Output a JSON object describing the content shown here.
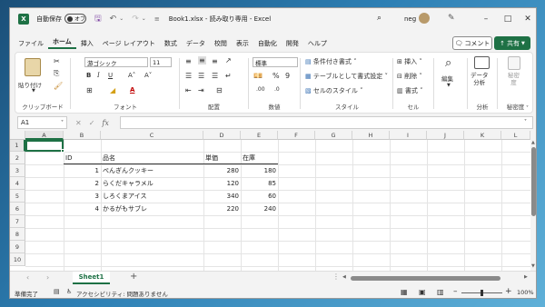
{
  "title": {
    "autosave_label": "自動保存",
    "autosave_state": "オフ",
    "doc_title": "Book1.xlsx  -  読み取り専用  -  Excel",
    "user": "neg"
  },
  "menu": [
    "ファイル",
    "ホーム",
    "挿入",
    "ページ レイアウト",
    "数式",
    "データ",
    "校閲",
    "表示",
    "自動化",
    "開発",
    "ヘルプ"
  ],
  "comment_label": "コメント",
  "share_label": "共有",
  "ribbon": {
    "clipboard": {
      "paste": "貼り付け",
      "label": "クリップボード"
    },
    "font": {
      "name": "游ゴシック",
      "size": "11",
      "label": "フォント"
    },
    "alignment": {
      "label": "配置"
    },
    "number": {
      "format": "標準",
      "label": "数値"
    },
    "styles": {
      "cond": "条件付き書式",
      "table": "テーブルとして書式設定",
      "cell": "セルのスタイル",
      "label": "スタイル"
    },
    "cells": {
      "insert": "挿入",
      "delete": "削除",
      "format": "書式",
      "label": "セル"
    },
    "editing": {
      "label": "編集"
    },
    "analysis": {
      "btn": "データ\n分析",
      "label": "分析"
    },
    "sensitivity": {
      "btn": "秘密\n度",
      "label": "秘密度"
    }
  },
  "formula_bar": {
    "name_box": "A1",
    "fx": "fx",
    "value": ""
  },
  "columns": [
    "A",
    "B",
    "C",
    "D",
    "E",
    "F",
    "G",
    "H",
    "I",
    "J",
    "K",
    "L"
  ],
  "rows": [
    "1",
    "2",
    "3",
    "4",
    "5",
    "6",
    "7",
    "8",
    "9",
    "10"
  ],
  "table": {
    "headers": [
      "ID",
      "品名",
      "単価",
      "在庫"
    ],
    "rows": [
      [
        "1",
        "ぺんぎんクッキー",
        "280",
        "180"
      ],
      [
        "2",
        "らくだキャラメル",
        "120",
        "85"
      ],
      [
        "3",
        "しろくまアイス",
        "340",
        "60"
      ],
      [
        "4",
        "かるがもサブレ",
        "220",
        "240"
      ]
    ]
  },
  "sheet_tab": "Sheet1",
  "status": {
    "ready": "準備完了",
    "accessibility": "アクセシビリティ: 問題ありません",
    "zoom": "100%"
  }
}
